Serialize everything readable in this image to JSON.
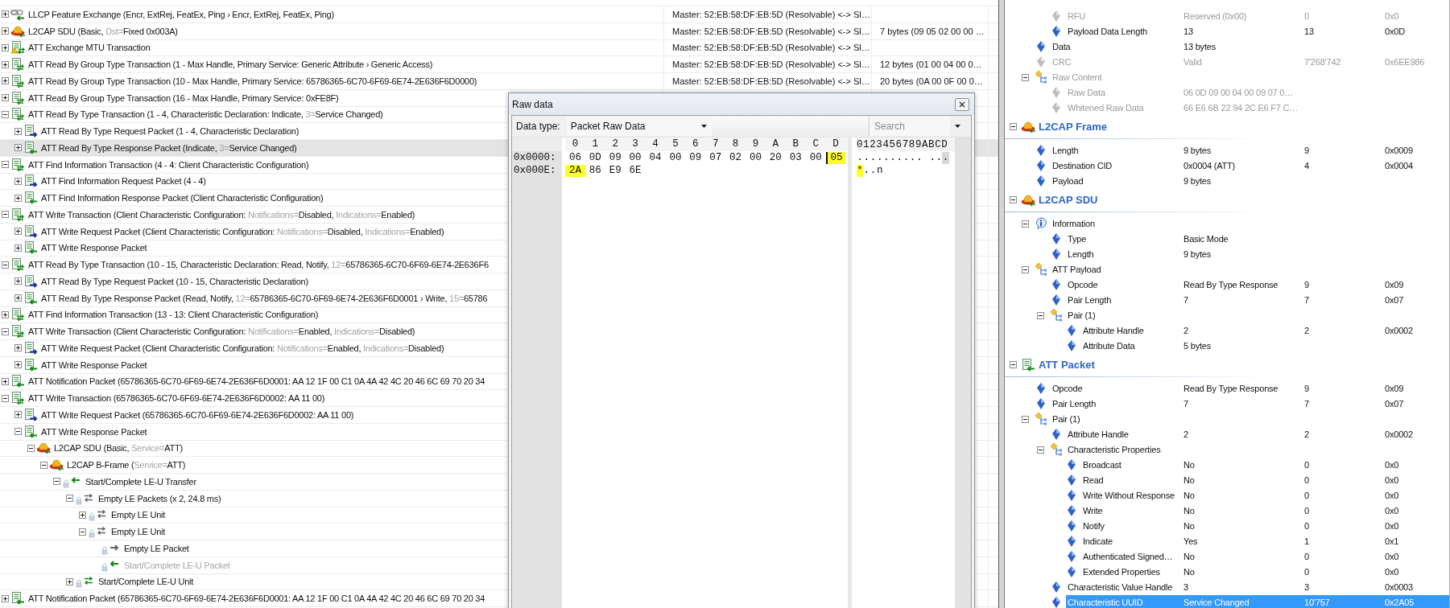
{
  "packet_list": {
    "rows": [
      {
        "label": "LLCP Feature Exchange (Encr, ExtRej, FeatEx, Ping › Encr, ExtRej, FeatEx, Ping)",
        "kind": "llcp",
        "expanded": false,
        "selected": false,
        "dimmed": false,
        "column_2": "Master: 52:EB:58:DF:EB:5D (Resolvable) <-> Sl…"
      },
      {
        "parts": [
          {
            "text": "L2CAP SDU (Basic, ",
            "muted": false
          },
          {
            "text": "Dst=",
            "muted": true
          },
          {
            "text": "Fixed 0x003A)",
            "muted": false
          }
        ],
        "kind": "l2cap",
        "expanded": false,
        "selected": false,
        "dimmed": false,
        "column_2": "Master: 52:EB:58:DF:EB:5D (Resolvable) <-> Sl…",
        "column_3": "7 bytes (09 05 02 00 00 …"
      },
      {
        "label": "ATT Exchange MTU Transaction",
        "kind": "att-warning",
        "expanded": false,
        "selected": false,
        "dimmed": false,
        "column_2": "Master: 52:EB:58:DF:EB:5D (Resolvable) <-> Sl…"
      },
      {
        "label": "ATT Read By Group Type Transaction (1 - Max Handle, Primary Service: Generic Attribute ›  Generic Access)",
        "kind": "att-transaction",
        "expanded": false,
        "selected": false,
        "dimmed": false,
        "column_2": "Master: 52:EB:58:DF:EB:5D (Resolvable) <-> Sl…",
        "column_3": "12 bytes (01 00 04 00 0…"
      },
      {
        "label": "ATT Read By Group Type Transaction (10 - Max Handle, Primary Service: 65786365-6C70-6F69-6E74-2E636F6D0000)",
        "kind": "att-transaction",
        "expanded": false,
        "selected": false,
        "dimmed": false,
        "column_2": "Master: 52:EB:58:DF:EB:5D (Resolvable) <-> Sl…",
        "column_3": "20 bytes (0A 00 0F 00 0…"
      },
      {
        "label": "ATT Read By Group Type Transaction (16 - Max Handle, Primary Service: 0xFE8F)",
        "kind": "att-transaction",
        "expanded": false,
        "selected": false,
        "dimmed": false
      },
      {
        "parts": [
          {
            "text": "ATT Read By Type Transaction (1 - 4, Characteristic Declaration: Indicate, ",
            "muted": false
          },
          {
            "text": "3=",
            "muted": true
          },
          {
            "text": "Service Changed)",
            "muted": false
          }
        ],
        "kind": "att-transaction",
        "expanded": true,
        "selected": false,
        "dimmed": false,
        "children": [
          {
            "label": "ATT Read By Type Request Packet (1 - 4, Characteristic Declaration)",
            "kind": "att-request",
            "expanded": false,
            "selected": false,
            "dimmed": false
          },
          {
            "parts": [
              {
                "text": "ATT Read By Type Response Packet (Indicate, ",
                "muted": false
              },
              {
                "text": "3=",
                "muted": true
              },
              {
                "text": "Service Changed)",
                "muted": false
              }
            ],
            "kind": "att-response",
            "expanded": false,
            "selected": true,
            "dimmed": false
          }
        ]
      },
      {
        "label": "ATT Find Information Transaction (4 - 4: Client Characteristic Configuration)",
        "kind": "att-transaction",
        "expanded": true,
        "selected": false,
        "dimmed": false,
        "children": [
          {
            "label": "ATT Find Information Request Packet (4 - 4)",
            "kind": "att-request",
            "expanded": false,
            "selected": false,
            "dimmed": false
          },
          {
            "label": "ATT Find Information Response Packet (Client Characteristic Configuration)",
            "kind": "att-response",
            "expanded": false,
            "selected": false,
            "dimmed": false
          }
        ]
      },
      {
        "parts": [
          {
            "text": "ATT Write Transaction (Client Characteristic Configuration: ",
            "muted": false
          },
          {
            "text": "Notifications=",
            "muted": true
          },
          {
            "text": "Disabled, ",
            "muted": false
          },
          {
            "text": "Indications=",
            "muted": true
          },
          {
            "text": "Enabled)",
            "muted": false
          }
        ],
        "kind": "att-transaction",
        "expanded": true,
        "selected": false,
        "dimmed": false,
        "children": [
          {
            "parts": [
              {
                "text": "ATT Write Request Packet (Client Characteristic Configuration: ",
                "muted": false
              },
              {
                "text": "Notifications=",
                "muted": true
              },
              {
                "text": "Disabled, ",
                "muted": false
              },
              {
                "text": "Indications=",
                "muted": true
              },
              {
                "text": "Enabled)",
                "muted": false
              }
            ],
            "kind": "att-request",
            "expanded": false,
            "selected": false,
            "dimmed": false
          },
          {
            "label": "ATT Write Response Packet",
            "kind": "att-response",
            "expanded": false,
            "selected": false,
            "dimmed": false
          }
        ]
      },
      {
        "parts": [
          {
            "text": "ATT Read By Type Transaction (10 - 15, Characteristic Declaration: Read, Notify, ",
            "muted": false
          },
          {
            "text": "12=",
            "muted": true
          },
          {
            "text": "65786365-6C70-6F69-6E74-2E636F6",
            "muted": false
          }
        ],
        "kind": "att-transaction",
        "expanded": true,
        "selected": false,
        "dimmed": false,
        "children": [
          {
            "label": "ATT Read By Type Request Packet (10 - 15, Characteristic Declaration)",
            "kind": "att-request",
            "expanded": false,
            "selected": false,
            "dimmed": false
          },
          {
            "parts": [
              {
                "text": "ATT Read By Type Response Packet (Read, Notify, ",
                "muted": false
              },
              {
                "text": "12=",
                "muted": true
              },
              {
                "text": "65786365-6C70-6F69-6E74-2E636F6D0001 › Write, ",
                "muted": false
              },
              {
                "text": "15=",
                "muted": true
              },
              {
                "text": "65786",
                "muted": false
              }
            ],
            "kind": "att-response",
            "expanded": false,
            "selected": false,
            "dimmed": false
          }
        ]
      },
      {
        "label": "ATT Find Information Transaction (13 - 13: Client Characteristic Configuration)",
        "kind": "att-transaction",
        "expanded": false,
        "selected": false,
        "dimmed": false
      },
      {
        "parts": [
          {
            "text": "ATT Write Transaction (Client Characteristic Configuration: ",
            "muted": false
          },
          {
            "text": "Notifications=",
            "muted": true
          },
          {
            "text": "Enabled, ",
            "muted": false
          },
          {
            "text": "Indications=",
            "muted": true
          },
          {
            "text": "Disabled)",
            "muted": false
          }
        ],
        "kind": "att-transaction",
        "expanded": true,
        "selected": false,
        "dimmed": false,
        "children": [
          {
            "parts": [
              {
                "text": "ATT Write Request Packet (Client Characteristic Configuration: ",
                "muted": false
              },
              {
                "text": "Notifications=",
                "muted": true
              },
              {
                "text": "Enabled, ",
                "muted": false
              },
              {
                "text": "Indications=",
                "muted": true
              },
              {
                "text": "Disabled)",
                "muted": false
              }
            ],
            "kind": "att-request",
            "expanded": false,
            "selected": false,
            "dimmed": false
          },
          {
            "label": "ATT Write Response Packet",
            "kind": "att-response",
            "expanded": false,
            "selected": false,
            "dimmed": false
          }
        ]
      },
      {
        "label": "ATT Notification Packet (65786365-6C70-6F69-6E74-2E636F6D0001: AA 12 1F 00 C1 0A 4A 42 4C 20 46 6C 69 70 20 34",
        "kind": "att-response",
        "expanded": false,
        "selected": false,
        "dimmed": false
      },
      {
        "label": "ATT Write Transaction (65786365-6C70-6F69-6E74-2E636F6D0002: AA 11 00)",
        "kind": "att-transaction",
        "expanded": true,
        "selected": false,
        "dimmed": false,
        "children": [
          {
            "label": "ATT Write Request Packet (65786365-6C70-6F69-6E74-2E636F6D0002: AA 11 00)",
            "kind": "att-request",
            "expanded": false,
            "selected": false,
            "dimmed": false
          },
          {
            "label": "ATT Write Response Packet",
            "kind": "att-response",
            "expanded": true,
            "selected": false,
            "dimmed": false,
            "children": [
              {
                "parts": [
                  {
                    "text": "L2CAP SDU (Basic, ",
                    "muted": false
                  },
                  {
                    "text": "Service=",
                    "muted": true
                  },
                  {
                    "text": "ATT)",
                    "muted": false
                  }
                ],
                "kind": "l2cap",
                "expanded": true,
                "selected": false,
                "dimmed": false,
                "children": [
                  {
                    "parts": [
                      {
                        "text": "L2CAP B-Frame (",
                        "muted": false
                      },
                      {
                        "text": "Service=",
                        "muted": true
                      },
                      {
                        "text": "ATT)",
                        "muted": false
                      }
                    ],
                    "kind": "l2cap",
                    "expanded": true,
                    "selected": false,
                    "dimmed": false,
                    "children": [
                      {
                        "label": "Start/Complete LE-U Transfer",
                        "kind": "le-transfer",
                        "expanded": true,
                        "selected": false,
                        "dimmed": false,
                        "children": [
                          {
                            "label": "Empty LE Packets (x 2, 24.8 ms)",
                            "kind": "le-packets",
                            "expanded": true,
                            "selected": false,
                            "dimmed": false,
                            "children": [
                              {
                                "label": "Empty LE Unit",
                                "kind": "le-unit",
                                "expanded": false,
                                "selected": false,
                                "dimmed": false
                              },
                              {
                                "label": "Empty LE Unit",
                                "kind": "le-unit",
                                "expanded": true,
                                "selected": false,
                                "dimmed": false,
                                "children": [
                                  {
                                    "label": "Empty LE Packet",
                                    "kind": "le-packet",
                                    "selected": false,
                                    "dimmed": false
                                  },
                                  {
                                    "label": "Start/Complete LE-U Packet",
                                    "kind": "le-u-packet",
                                    "selected": false,
                                    "dimmed": true
                                  }
                                ]
                              }
                            ]
                          },
                          {
                            "label": "Start/Complete LE-U Unit",
                            "kind": "le-u-unit",
                            "expanded": false,
                            "selected": false,
                            "dimmed": false
                          }
                        ]
                      }
                    ]
                  }
                ]
              }
            ]
          }
        ]
      },
      {
        "label": "ATT Notification Packet (65786365-6C70-6F69-6E74-2E636F6D0001: AA 12 1F 00 C1 0A 4A 42 4C 20 46 6C 69 70 20 34",
        "kind": "att-response",
        "expanded": false,
        "selected": false,
        "dimmed": false
      }
    ]
  },
  "raw_data_window": {
    "title": "Raw data",
    "data_type_label": "Data type:",
    "data_type_value": "Packet Raw Data",
    "search": {
      "placeholder": "Search"
    },
    "column_headers": [
      "0",
      "1",
      "2",
      "3",
      "4",
      "5",
      "6",
      "7",
      "8",
      "9",
      "A",
      "B",
      "C",
      "D"
    ],
    "ascii_header": "0123456789ABCD",
    "rows": [
      {
        "offset": "0x0000:",
        "bytes": [
          {
            "hex": "06",
            "char": ".",
            "highlighted": false,
            "cursor": false
          },
          {
            "hex": "0D",
            "char": ".",
            "highlighted": false,
            "cursor": false
          },
          {
            "hex": "09",
            "char": ".",
            "highlighted": false,
            "cursor": false
          },
          {
            "hex": "00",
            "char": ".",
            "highlighted": false,
            "cursor": false
          },
          {
            "hex": "04",
            "char": ".",
            "highlighted": false,
            "cursor": false
          },
          {
            "hex": "00",
            "char": ".",
            "highlighted": false,
            "cursor": false
          },
          {
            "hex": "09",
            "char": ".",
            "highlighted": false,
            "cursor": false
          },
          {
            "hex": "07",
            "char": ".",
            "highlighted": false,
            "cursor": false
          },
          {
            "hex": "02",
            "char": ".",
            "highlighted": false,
            "cursor": false
          },
          {
            "hex": "00",
            "char": ".",
            "highlighted": false,
            "cursor": false
          },
          {
            "hex": "20",
            "highlighted": false,
            "cursor": false
          },
          {
            "hex": "03",
            "char": ".",
            "highlighted": false,
            "cursor": false
          },
          {
            "hex": "00",
            "char": ".",
            "highlighted": false,
            "cursor": false
          },
          {
            "hex": "05",
            "char": ".",
            "highlighted": true,
            "cursor": true
          }
        ]
      },
      {
        "offset": "0x000E:",
        "bytes": [
          {
            "hex": "2A",
            "char": "*",
            "highlighted": true,
            "cursor": false
          },
          {
            "hex": "86",
            "char": ".",
            "highlighted": false,
            "cursor": false
          },
          {
            "hex": "E9",
            "char": ".",
            "highlighted": false,
            "cursor": false
          },
          {
            "hex": "6E",
            "char": "n",
            "highlighted": false,
            "cursor": false
          }
        ]
      }
    ]
  },
  "details": {
    "sections": [
      {
        "items": [
          {
            "children": [
              {
                "name": "RFU",
                "value": "Reserved (0x00)",
                "decimal": "0",
                "hex": "0x0",
                "kind": "field",
                "dimmed": true,
                "selected": false
              },
              {
                "name": "Payload Data Length",
                "value": "13",
                "decimal": "13",
                "hex": "0x0D",
                "kind": "field",
                "dimmed": false,
                "selected": false
              }
            ]
          },
          {
            "name": "Data",
            "value": "13 bytes",
            "kind": "field",
            "dimmed": false,
            "selected": false
          },
          {
            "name": "CRC",
            "value": "Valid",
            "decimal": "7'268'742",
            "hex": "0x6EE986",
            "kind": "field",
            "dimmed": true,
            "selected": false
          },
          {
            "name": "Raw Content",
            "kind": "group",
            "expanded": true,
            "dimmed": true,
            "selected": false,
            "children": [
              {
                "name": "Raw Data",
                "value": "06 0D 09 00 04 00 09 07 0…",
                "kind": "field",
                "dimmed": true,
                "selected": false
              },
              {
                "name": "Whitened Raw Data",
                "value": "66 E6 6B 22 94 2C E6 F7 C…",
                "kind": "field",
                "dimmed": true,
                "selected": false
              }
            ]
          }
        ]
      },
      {
        "title": "L2CAP Frame",
        "kind": "l2cap",
        "expanded": true,
        "items": [
          {
            "name": "Length",
            "value": "9 bytes",
            "decimal": "9",
            "hex": "0x0009",
            "kind": "field",
            "dimmed": false,
            "selected": false
          },
          {
            "name": "Destination CID",
            "value": "0x0004 (ATT)",
            "decimal": "4",
            "hex": "0x0004",
            "kind": "field",
            "dimmed": false,
            "selected": false
          },
          {
            "name": "Payload",
            "value": "9 bytes",
            "kind": "field",
            "dimmed": false,
            "selected": false
          }
        ]
      },
      {
        "title": "L2CAP SDU",
        "kind": "l2cap",
        "expanded": true,
        "items": [
          {
            "name": "Information",
            "kind": "info",
            "expanded": true,
            "dimmed": false,
            "selected": false,
            "children": [
              {
                "name": "Type",
                "value": "Basic Mode",
                "kind": "field",
                "dimmed": false,
                "selected": false
              },
              {
                "name": "Length",
                "value": "9 bytes",
                "kind": "field",
                "dimmed": false,
                "selected": false
              }
            ]
          },
          {
            "name": "ATT Payload",
            "kind": "group",
            "expanded": true,
            "dimmed": false,
            "selected": false,
            "children": [
              {
                "name": "Opcode",
                "value": "Read By Type Response",
                "decimal": "9",
                "hex": "0x09",
                "kind": "field",
                "dimmed": false,
                "selected": false
              },
              {
                "name": "Pair Length",
                "value": "7",
                "decimal": "7",
                "hex": "0x07",
                "kind": "field",
                "dimmed": false,
                "selected": false
              },
              {
                "name": "Pair (1)",
                "kind": "group",
                "expanded": true,
                "dimmed": false,
                "selected": false,
                "children": [
                  {
                    "name": "Attribute Handle",
                    "value": "2",
                    "decimal": "2",
                    "hex": "0x0002",
                    "kind": "field",
                    "dimmed": false,
                    "selected": false
                  },
                  {
                    "name": "Attribute Data",
                    "value": "5 bytes",
                    "kind": "field",
                    "dimmed": false,
                    "selected": false
                  }
                ]
              }
            ]
          }
        ]
      },
      {
        "title": "ATT Packet",
        "kind": "att-response",
        "expanded": true,
        "items": [
          {
            "name": "Opcode",
            "value": "Read By Type Response",
            "decimal": "9",
            "hex": "0x09",
            "kind": "field",
            "dimmed": false,
            "selected": false
          },
          {
            "name": "Pair Length",
            "value": "7",
            "decimal": "7",
            "hex": "0x07",
            "kind": "field",
            "dimmed": false,
            "selected": false
          },
          {
            "name": "Pair (1)",
            "kind": "group",
            "expanded": true,
            "dimmed": false,
            "selected": false,
            "children": [
              {
                "name": "Attribute Handle",
                "value": "2",
                "decimal": "2",
                "hex": "0x0002",
                "kind": "field",
                "dimmed": false,
                "selected": false
              },
              {
                "name": "Characteristic Properties",
                "kind": "group",
                "expanded": true,
                "dimmed": false,
                "selected": false,
                "children": [
                  {
                    "name": "Broadcast",
                    "value": "No",
                    "decimal": "0",
                    "hex": "0x0",
                    "kind": "field",
                    "dimmed": false,
                    "selected": false
                  },
                  {
                    "name": "Read",
                    "value": "No",
                    "decimal": "0",
                    "hex": "0x0",
                    "kind": "field",
                    "dimmed": false,
                    "selected": false
                  },
                  {
                    "name": "Write Without Response",
                    "value": "No",
                    "decimal": "0",
                    "hex": "0x0",
                    "kind": "field",
                    "dimmed": false,
                    "selected": false
                  },
                  {
                    "name": "Write",
                    "value": "No",
                    "decimal": "0",
                    "hex": "0x0",
                    "kind": "field",
                    "dimmed": false,
                    "selected": false
                  },
                  {
                    "name": "Notify",
                    "value": "No",
                    "decimal": "0",
                    "hex": "0x0",
                    "kind": "field",
                    "dimmed": false,
                    "selected": false
                  },
                  {
                    "name": "Indicate",
                    "value": "Yes",
                    "decimal": "1",
                    "hex": "0x1",
                    "kind": "field",
                    "dimmed": false,
                    "selected": false
                  },
                  {
                    "name": "Authenticated Signed…",
                    "value": "No",
                    "decimal": "0",
                    "hex": "0x0",
                    "kind": "field",
                    "dimmed": false,
                    "selected": false
                  },
                  {
                    "name": "Extended Properties",
                    "value": "No",
                    "decimal": "0",
                    "hex": "0x0",
                    "kind": "field",
                    "dimmed": false,
                    "selected": false
                  }
                ]
              },
              {
                "name": "Characteristic Value Handle",
                "value": "3",
                "decimal": "3",
                "hex": "0x0003",
                "kind": "field",
                "dimmed": false,
                "selected": false
              },
              {
                "name": "Characteristic UUID",
                "value": "Service Changed",
                "decimal": "10'757",
                "hex": "0x2A05",
                "kind": "field",
                "dimmed": false,
                "selected": true
              }
            ]
          }
        ]
      }
    ]
  }
}
